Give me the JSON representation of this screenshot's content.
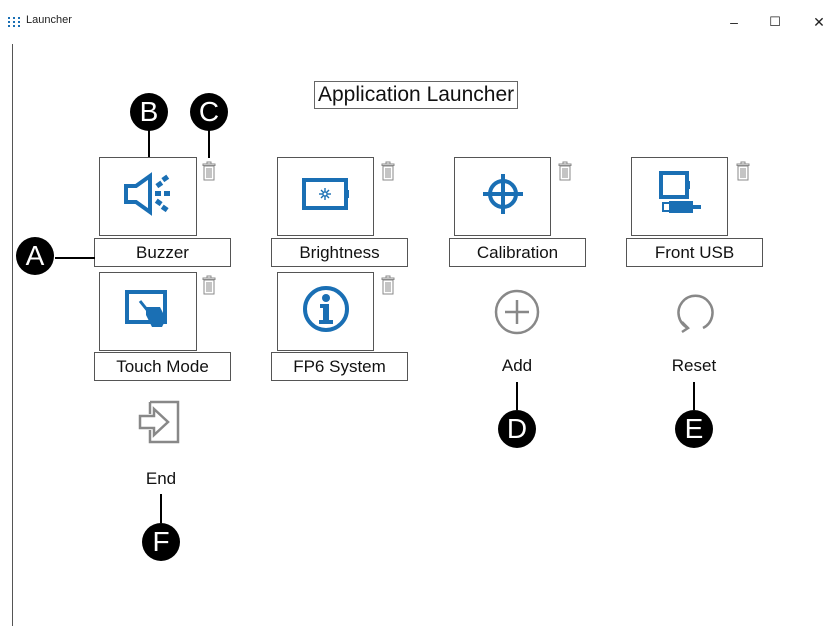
{
  "window": {
    "title": "Launcher",
    "controls": [
      "–",
      "☐",
      "✕"
    ]
  },
  "heading": "Application Launcher",
  "apps": [
    {
      "label": "Buzzer",
      "icon": "speaker-icon"
    },
    {
      "label": "Brightness",
      "icon": "brightness-icon"
    },
    {
      "label": "Calibration",
      "icon": "crosshair-icon"
    },
    {
      "label": "Front USB",
      "icon": "usb-icon"
    },
    {
      "label": "Touch Mode",
      "icon": "touch-mode-icon"
    },
    {
      "label": "FP6 System",
      "icon": "info-icon"
    }
  ],
  "actions": {
    "add": "Add",
    "reset": "Reset",
    "end": "End"
  },
  "markers": [
    "A",
    "B",
    "C",
    "D",
    "E",
    "F"
  ],
  "colors": {
    "accent": "#1a6fb4",
    "gray": "#888888"
  }
}
